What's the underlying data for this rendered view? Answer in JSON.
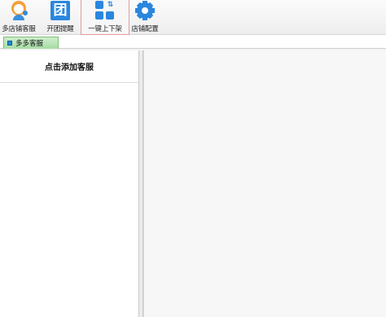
{
  "toolbar": {
    "items": [
      {
        "label": "多店铺客服",
        "icon": "customer-service-icon"
      },
      {
        "label": "开团提醒",
        "icon": "group-tuan-icon"
      },
      {
        "label": "一键上下架",
        "icon": "apps-updown-icon",
        "tuan_glyph": "⇅"
      },
      {
        "label": "店铺配置",
        "icon": "gear-icon"
      }
    ],
    "tuan_char": "团"
  },
  "tabs": [
    {
      "label": "多多客服",
      "active": true
    }
  ],
  "left_panel": {
    "add_label": "点击添加客服"
  },
  "colors": {
    "accent": "#2a86de",
    "tab_green": "#a6dca5",
    "active_outline": "#e39a9a"
  }
}
